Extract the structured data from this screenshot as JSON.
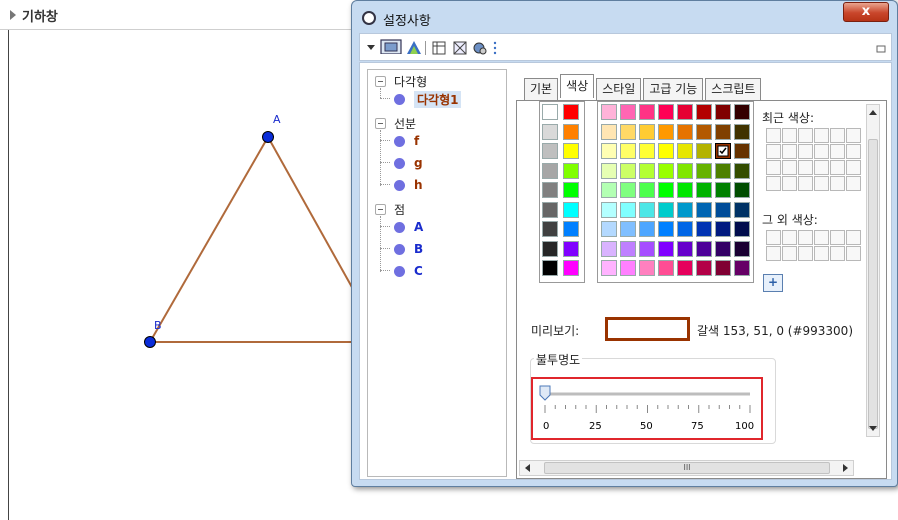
{
  "geometry": {
    "header_title": "기하창",
    "points": [
      {
        "label": "A"
      },
      {
        "label": "B"
      }
    ],
    "colors": {
      "triangle": "#b06a3b",
      "point": "#0a2cd9"
    }
  },
  "dialog": {
    "title": "설정사항",
    "close_label": "x",
    "tree": {
      "groups": [
        {
          "label": "다각형",
          "items": [
            {
              "label": "다각형1",
              "color": "#993300",
              "selected": true
            }
          ]
        },
        {
          "label": "선분",
          "items": [
            {
              "label": "f",
              "color": "#993300"
            },
            {
              "label": "g",
              "color": "#993300"
            },
            {
              "label": "h",
              "color": "#993300"
            }
          ]
        },
        {
          "label": "점",
          "items": [
            {
              "label": "A",
              "color": "#1a2ccd"
            },
            {
              "label": "B",
              "color": "#1a2ccd"
            },
            {
              "label": "C",
              "color": "#1a2ccd"
            }
          ]
        }
      ]
    },
    "tabs": [
      "기본",
      "색상",
      "스타일",
      "고급 기능",
      "스크립트"
    ],
    "active_tab": "색상",
    "recent_colors_label": "최근 색상:",
    "other_colors_label": "그 외 색상:",
    "add_color_label": "+",
    "preview_label": "미리보기:",
    "color_name": "갈색 153, 51, 0 (#993300)",
    "opacity_label": "불투명도",
    "opacity_ticks": [
      "0",
      "25",
      "50",
      "75",
      "100"
    ],
    "opacity_value": 0,
    "scroll_label": "III",
    "gray_column": [
      "#ffffff",
      "#d9d9d9",
      "#bfbfbf",
      "#a6a6a6",
      "#808080",
      "#666666",
      "#404040",
      "#262626",
      "#000000"
    ],
    "bright_column": [
      "#ff0000",
      "#ff8000",
      "#ffff00",
      "#80ff00",
      "#00ff00",
      "#00ffff",
      "#0080ff",
      "#8000ff",
      "#ff00ff"
    ],
    "palette": [
      [
        "#ffb3d9",
        "#ff66b3",
        "#ff3385",
        "#ff0055",
        "#e60033",
        "#b30000",
        "#800000",
        "#330000"
      ],
      [
        "#ffe6b3",
        "#ffd966",
        "#ffcc33",
        "#ff9900",
        "#e67300",
        "#b35900",
        "#804000",
        "#403300"
      ],
      [
        "#ffffb3",
        "#ffff66",
        "#ffff33",
        "#ffff00",
        "#e6e600",
        "#b3b300",
        "#993300",
        "#663300"
      ],
      [
        "#e6ffb3",
        "#ccff66",
        "#b3ff33",
        "#99ff00",
        "#80e600",
        "#66b300",
        "#4d8000",
        "#334d00"
      ],
      [
        "#b3ffb3",
        "#80ff80",
        "#4dff4d",
        "#00ff00",
        "#00e600",
        "#00b300",
        "#008000",
        "#004d00"
      ],
      [
        "#b3ffff",
        "#80ffff",
        "#4de6e6",
        "#00cccc",
        "#0099cc",
        "#0066b3",
        "#004d99",
        "#003366"
      ],
      [
        "#b3d9ff",
        "#80bfff",
        "#4da6ff",
        "#0080ff",
        "#0066e6",
        "#0033b3",
        "#001a80",
        "#000d4d"
      ],
      [
        "#d9b3ff",
        "#bf80ff",
        "#a64dff",
        "#8000ff",
        "#6600cc",
        "#4d0099",
        "#330066",
        "#1a0033"
      ],
      [
        "#ffb3ff",
        "#ff80ff",
        "#ff80bf",
        "#ff4d94",
        "#e6005c",
        "#b30047",
        "#800033",
        "#660066"
      ]
    ],
    "selected_swatch": "#993300"
  }
}
